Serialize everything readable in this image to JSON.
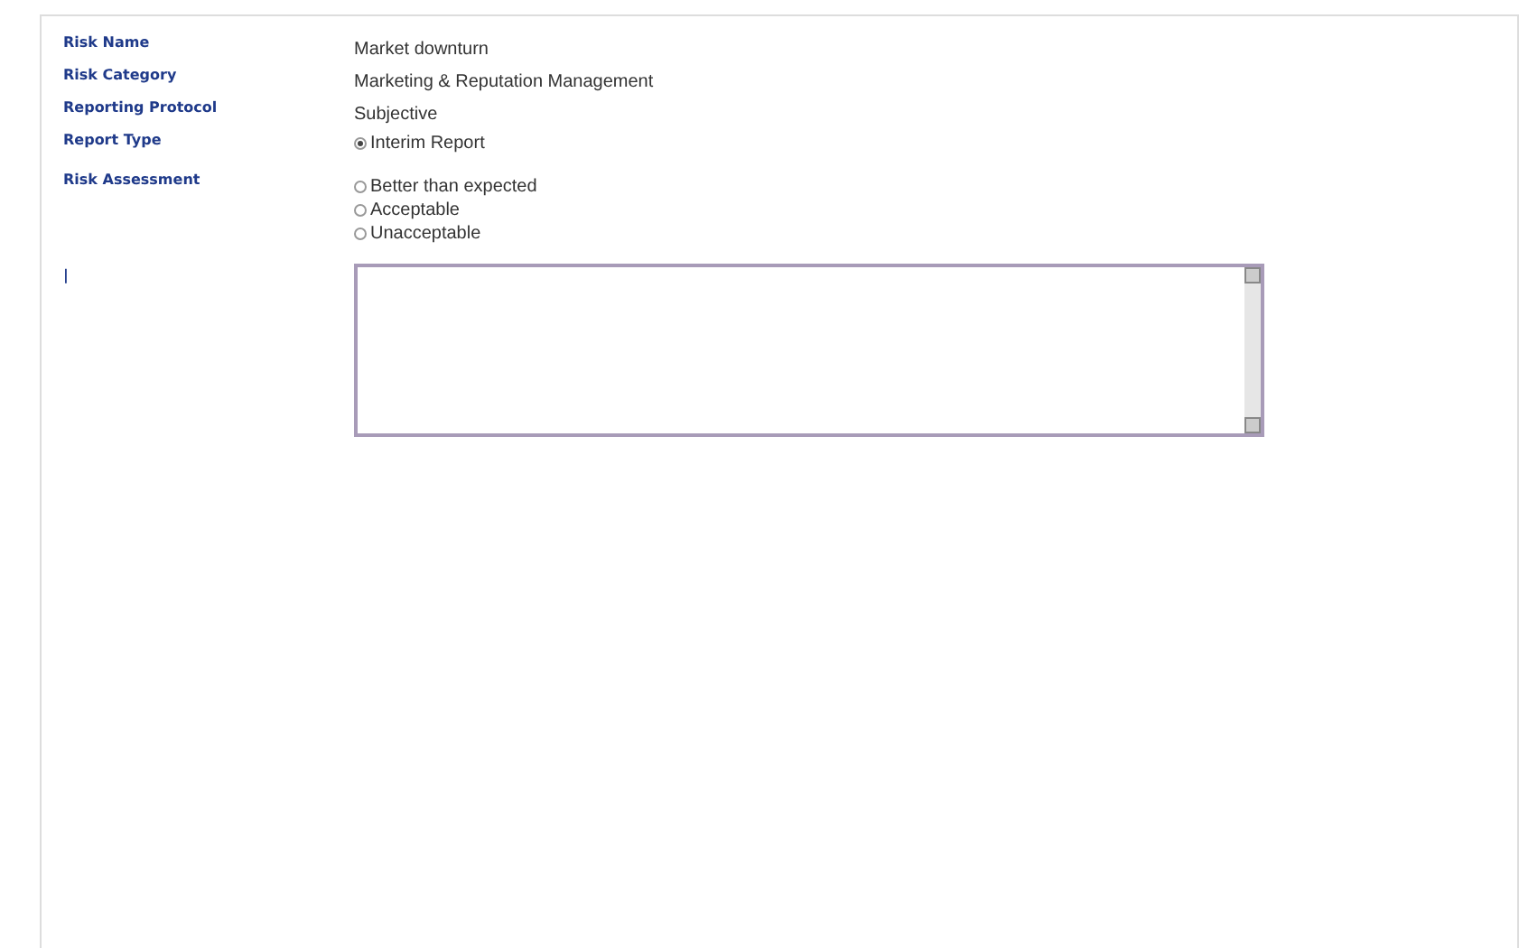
{
  "fields": [
    {
      "label": "Risk Name",
      "kind": "text",
      "value": "Market downturn"
    },
    {
      "label": "Risk Category",
      "kind": "text",
      "value": "Marketing & Reputation Management"
    },
    {
      "label": "Reporting Protocol",
      "kind": "text",
      "value": "Subjective"
    },
    {
      "label": "Report Type",
      "kind": "radio",
      "options": [
        {
          "label": "Interim Report",
          "selected": true
        }
      ]
    },
    {
      "label": "Risk Assessment",
      "kind": "radio",
      "options": [
        {
          "label": "Better than expected",
          "selected": false
        },
        {
          "label": "Acceptable",
          "selected": false
        },
        {
          "label": "Unacceptable",
          "selected": false
        }
      ]
    },
    {
      "label": "|",
      "kind": "textarea"
    }
  ]
}
